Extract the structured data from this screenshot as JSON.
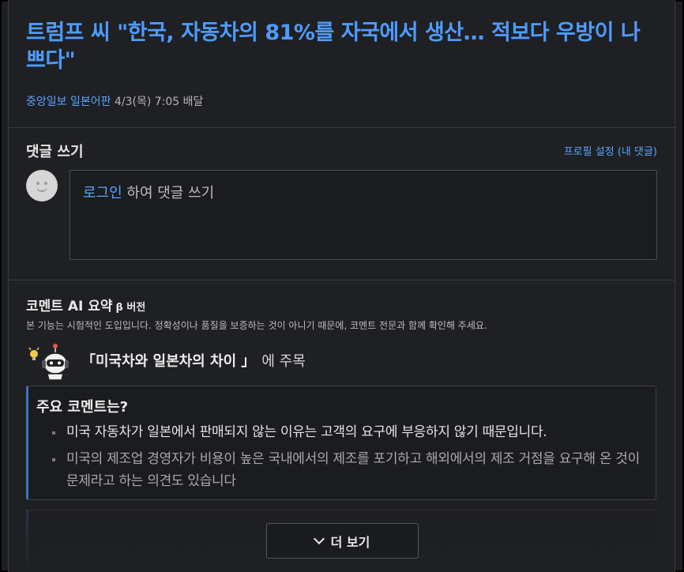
{
  "article": {
    "title": "트럼프 씨 \"한국, 자동차의 81%를 자국에서 생산… 적보다 우방이 나쁘다\"",
    "source": "중앙일보 일본어판",
    "date": "4/3(목) 7:05 배달"
  },
  "write_comment": {
    "heading": "댓글 쓰기",
    "profile_link": "프로필 설정 (내 댓글)",
    "login_label": "로그인",
    "prompt": " 하여 댓글 쓰기"
  },
  "ai_summary": {
    "heading": "코멘트 AI 요약",
    "beta": "β 버전",
    "notice": "본 기능는 시험적인 도입입니다. 정확성이나 품질을 보증하는 것이 아니기 때문에, 코멘트 전문과 함께 확인해 주세요.",
    "focus_topic": "「미국차와 일본차의 차이 」",
    "focus_suffix": "에 주목",
    "box_title": "주요 코멘트는?",
    "items": [
      "미국 자동차가 일본에서 판매되지 않는 이유는 고객의 요구에 부응하지 않기 때문입니다.",
      "미국의 제조업 경영자가 비용이 높은 국내에서의 제조를 포기하고 해외에서의 제조 거점을 요구해 온 것이 문제라고 하는 의견도 있습니다"
    ]
  },
  "more_button": {
    "label": "더 보기",
    "icon": "chevron-down-icon"
  },
  "colors": {
    "accent": "#4e9bff",
    "link": "#5aa3ff",
    "background": "#1f2023",
    "summary_bar": "#3b75c4"
  }
}
